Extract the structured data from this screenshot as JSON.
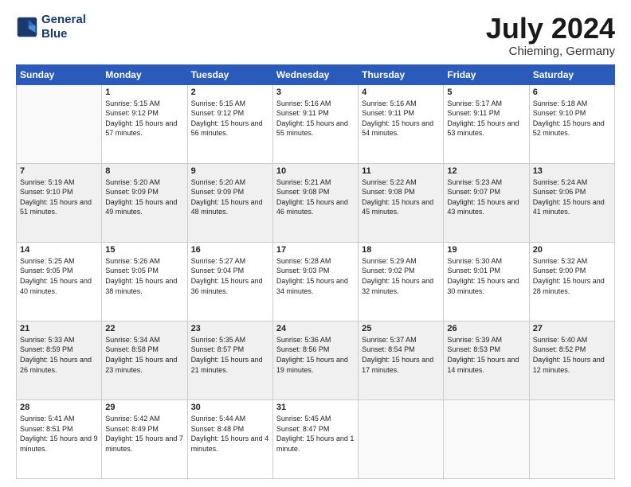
{
  "header": {
    "logo_line1": "General",
    "logo_line2": "Blue",
    "month": "July 2024",
    "location": "Chieming, Germany"
  },
  "weekdays": [
    "Sunday",
    "Monday",
    "Tuesday",
    "Wednesday",
    "Thursday",
    "Friday",
    "Saturday"
  ],
  "weeks": [
    [
      {
        "day": "",
        "sunrise": "",
        "sunset": "",
        "daylight": ""
      },
      {
        "day": "1",
        "sunrise": "Sunrise: 5:15 AM",
        "sunset": "Sunset: 9:12 PM",
        "daylight": "Daylight: 15 hours and 57 minutes."
      },
      {
        "day": "2",
        "sunrise": "Sunrise: 5:15 AM",
        "sunset": "Sunset: 9:12 PM",
        "daylight": "Daylight: 15 hours and 56 minutes."
      },
      {
        "day": "3",
        "sunrise": "Sunrise: 5:16 AM",
        "sunset": "Sunset: 9:11 PM",
        "daylight": "Daylight: 15 hours and 55 minutes."
      },
      {
        "day": "4",
        "sunrise": "Sunrise: 5:16 AM",
        "sunset": "Sunset: 9:11 PM",
        "daylight": "Daylight: 15 hours and 54 minutes."
      },
      {
        "day": "5",
        "sunrise": "Sunrise: 5:17 AM",
        "sunset": "Sunset: 9:11 PM",
        "daylight": "Daylight: 15 hours and 53 minutes."
      },
      {
        "day": "6",
        "sunrise": "Sunrise: 5:18 AM",
        "sunset": "Sunset: 9:10 PM",
        "daylight": "Daylight: 15 hours and 52 minutes."
      }
    ],
    [
      {
        "day": "7",
        "sunrise": "Sunrise: 5:19 AM",
        "sunset": "Sunset: 9:10 PM",
        "daylight": "Daylight: 15 hours and 51 minutes."
      },
      {
        "day": "8",
        "sunrise": "Sunrise: 5:20 AM",
        "sunset": "Sunset: 9:09 PM",
        "daylight": "Daylight: 15 hours and 49 minutes."
      },
      {
        "day": "9",
        "sunrise": "Sunrise: 5:20 AM",
        "sunset": "Sunset: 9:09 PM",
        "daylight": "Daylight: 15 hours and 48 minutes."
      },
      {
        "day": "10",
        "sunrise": "Sunrise: 5:21 AM",
        "sunset": "Sunset: 9:08 PM",
        "daylight": "Daylight: 15 hours and 46 minutes."
      },
      {
        "day": "11",
        "sunrise": "Sunrise: 5:22 AM",
        "sunset": "Sunset: 9:08 PM",
        "daylight": "Daylight: 15 hours and 45 minutes."
      },
      {
        "day": "12",
        "sunrise": "Sunrise: 5:23 AM",
        "sunset": "Sunset: 9:07 PM",
        "daylight": "Daylight: 15 hours and 43 minutes."
      },
      {
        "day": "13",
        "sunrise": "Sunrise: 5:24 AM",
        "sunset": "Sunset: 9:06 PM",
        "daylight": "Daylight: 15 hours and 41 minutes."
      }
    ],
    [
      {
        "day": "14",
        "sunrise": "Sunrise: 5:25 AM",
        "sunset": "Sunset: 9:05 PM",
        "daylight": "Daylight: 15 hours and 40 minutes."
      },
      {
        "day": "15",
        "sunrise": "Sunrise: 5:26 AM",
        "sunset": "Sunset: 9:05 PM",
        "daylight": "Daylight: 15 hours and 38 minutes."
      },
      {
        "day": "16",
        "sunrise": "Sunrise: 5:27 AM",
        "sunset": "Sunset: 9:04 PM",
        "daylight": "Daylight: 15 hours and 36 minutes."
      },
      {
        "day": "17",
        "sunrise": "Sunrise: 5:28 AM",
        "sunset": "Sunset: 9:03 PM",
        "daylight": "Daylight: 15 hours and 34 minutes."
      },
      {
        "day": "18",
        "sunrise": "Sunrise: 5:29 AM",
        "sunset": "Sunset: 9:02 PM",
        "daylight": "Daylight: 15 hours and 32 minutes."
      },
      {
        "day": "19",
        "sunrise": "Sunrise: 5:30 AM",
        "sunset": "Sunset: 9:01 PM",
        "daylight": "Daylight: 15 hours and 30 minutes."
      },
      {
        "day": "20",
        "sunrise": "Sunrise: 5:32 AM",
        "sunset": "Sunset: 9:00 PM",
        "daylight": "Daylight: 15 hours and 28 minutes."
      }
    ],
    [
      {
        "day": "21",
        "sunrise": "Sunrise: 5:33 AM",
        "sunset": "Sunset: 8:59 PM",
        "daylight": "Daylight: 15 hours and 26 minutes."
      },
      {
        "day": "22",
        "sunrise": "Sunrise: 5:34 AM",
        "sunset": "Sunset: 8:58 PM",
        "daylight": "Daylight: 15 hours and 23 minutes."
      },
      {
        "day": "23",
        "sunrise": "Sunrise: 5:35 AM",
        "sunset": "Sunset: 8:57 PM",
        "daylight": "Daylight: 15 hours and 21 minutes."
      },
      {
        "day": "24",
        "sunrise": "Sunrise: 5:36 AM",
        "sunset": "Sunset: 8:56 PM",
        "daylight": "Daylight: 15 hours and 19 minutes."
      },
      {
        "day": "25",
        "sunrise": "Sunrise: 5:37 AM",
        "sunset": "Sunset: 8:54 PM",
        "daylight": "Daylight: 15 hours and 17 minutes."
      },
      {
        "day": "26",
        "sunrise": "Sunrise: 5:39 AM",
        "sunset": "Sunset: 8:53 PM",
        "daylight": "Daylight: 15 hours and 14 minutes."
      },
      {
        "day": "27",
        "sunrise": "Sunrise: 5:40 AM",
        "sunset": "Sunset: 8:52 PM",
        "daylight": "Daylight: 15 hours and 12 minutes."
      }
    ],
    [
      {
        "day": "28",
        "sunrise": "Sunrise: 5:41 AM",
        "sunset": "Sunset: 8:51 PM",
        "daylight": "Daylight: 15 hours and 9 minutes."
      },
      {
        "day": "29",
        "sunrise": "Sunrise: 5:42 AM",
        "sunset": "Sunset: 8:49 PM",
        "daylight": "Daylight: 15 hours and 7 minutes."
      },
      {
        "day": "30",
        "sunrise": "Sunrise: 5:44 AM",
        "sunset": "Sunset: 8:48 PM",
        "daylight": "Daylight: 15 hours and 4 minutes."
      },
      {
        "day": "31",
        "sunrise": "Sunrise: 5:45 AM",
        "sunset": "Sunset: 8:47 PM",
        "daylight": "Daylight: 15 hours and 1 minute."
      },
      {
        "day": "",
        "sunrise": "",
        "sunset": "",
        "daylight": ""
      },
      {
        "day": "",
        "sunrise": "",
        "sunset": "",
        "daylight": ""
      },
      {
        "day": "",
        "sunrise": "",
        "sunset": "",
        "daylight": ""
      }
    ]
  ]
}
